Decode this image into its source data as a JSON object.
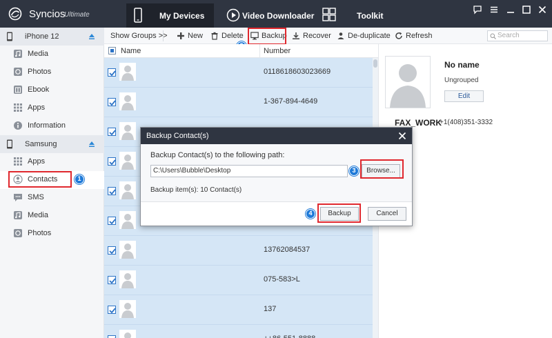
{
  "app": {
    "name": "Syncios",
    "edition": "Ultimate"
  },
  "nav": {
    "tabs": [
      {
        "label": "My Devices",
        "active": true
      },
      {
        "label": "Video Downloader"
      },
      {
        "label": "Toolkit"
      }
    ]
  },
  "sidebar": {
    "devices": [
      {
        "name": "iPhone 12",
        "items": [
          {
            "label": "Media",
            "icon": "music-icon"
          },
          {
            "label": "Photos",
            "icon": "photo-icon"
          },
          {
            "label": "Ebook",
            "icon": "book-icon"
          },
          {
            "label": "Apps",
            "icon": "apps-grid-icon"
          },
          {
            "label": "Information",
            "icon": "info-icon"
          }
        ]
      },
      {
        "name": "Samsung",
        "items": [
          {
            "label": "Apps",
            "icon": "apps-grid-icon"
          },
          {
            "label": "Contacts",
            "icon": "contact-icon",
            "active": true
          },
          {
            "label": "SMS",
            "icon": "sms-icon"
          },
          {
            "label": "Media",
            "icon": "music-icon"
          },
          {
            "label": "Photos",
            "icon": "photo-icon"
          }
        ]
      }
    ]
  },
  "toolbar": {
    "show_groups": "Show Groups >>",
    "new": "New",
    "delete": "Delete",
    "backup": "Backup",
    "recover": "Recover",
    "deduplicate": "De-duplicate",
    "refresh": "Refresh",
    "search_placeholder": "Search"
  },
  "list": {
    "columns": [
      "Name",
      "Number"
    ],
    "rows": [
      {
        "number": "0118618603023669"
      },
      {
        "number": "1-367-894-4649"
      },
      {
        "number": ""
      },
      {
        "number": ""
      },
      {
        "number": ""
      },
      {
        "number": ""
      },
      {
        "number": "13762084537"
      },
      {
        "number": "075-583>L"
      },
      {
        "number": "137"
      },
      {
        "number": "++86-551-8888"
      }
    ]
  },
  "detail": {
    "name": "No name",
    "group": "Ungrouped",
    "edit": "Edit",
    "fax_label": "FAX_WORK",
    "fax_value": "+1(408)351-3332"
  },
  "dialog": {
    "title": "Backup Contact(s)",
    "path_label": "Backup Contact(s) to the following path:",
    "path_value": "C:\\Users\\Bubble\\Desktop",
    "browse": "Browse...",
    "info": "Backup item(s): 10 Contact(s)",
    "backup": "Backup",
    "cancel": "Cancel"
  },
  "steps": [
    "1",
    "2",
    "3",
    "4"
  ],
  "colors": {
    "titlebar": "#2f3541",
    "accent": "#1f7ad8",
    "highlight": "#e0272d",
    "selected_row": "#d5e6f6"
  }
}
